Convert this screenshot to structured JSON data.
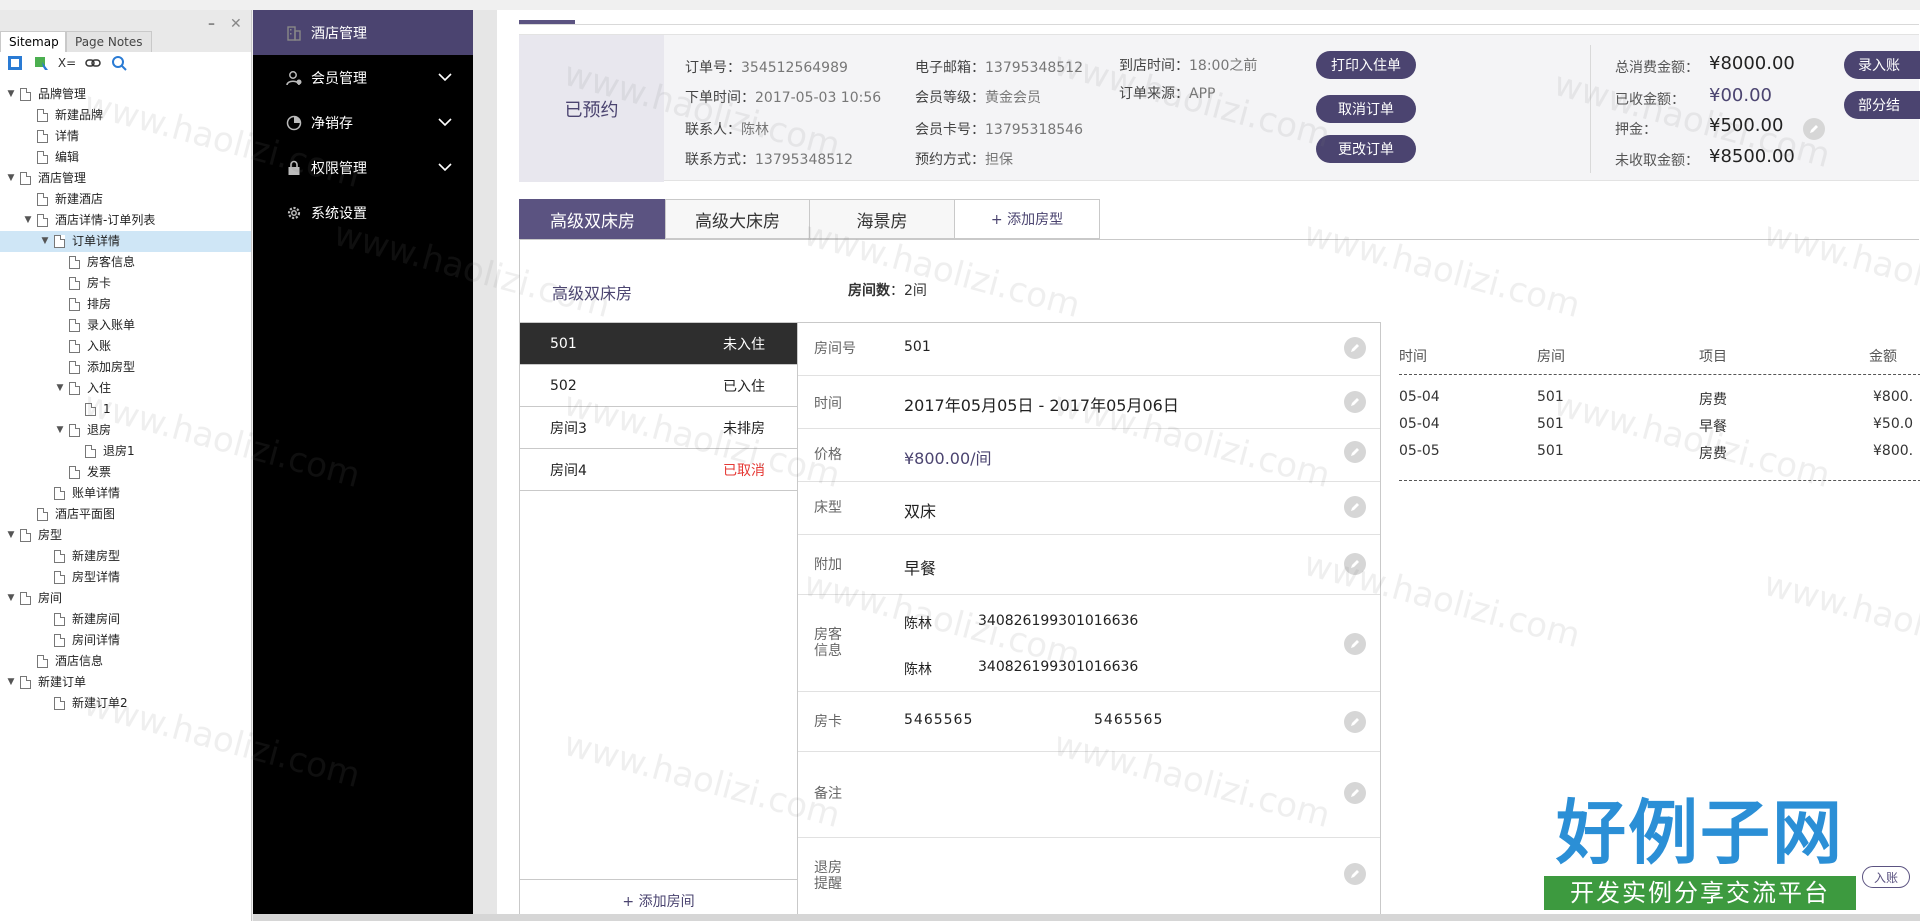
{
  "sitemap": {
    "tabs": [
      "Sitemap",
      "Page Notes"
    ],
    "tool_label": "X=",
    "tree": [
      {
        "label": "品牌管理",
        "depth": 0,
        "toggle": "▼",
        "page": true
      },
      {
        "label": "新建品牌",
        "depth": 2,
        "toggle": "",
        "page": true
      },
      {
        "label": "详情",
        "depth": 2,
        "toggle": "",
        "page": true
      },
      {
        "label": "编辑",
        "depth": 2,
        "toggle": "",
        "page": true
      },
      {
        "label": "酒店管理",
        "depth": 0,
        "toggle": "▼",
        "page": true
      },
      {
        "label": "新建酒店",
        "depth": 2,
        "toggle": "",
        "page": true
      },
      {
        "label": "酒店详情-订单列表",
        "depth": 2,
        "toggle": "▼",
        "page": true
      },
      {
        "label": "订单详情",
        "depth": 3,
        "toggle": "▼",
        "page": true,
        "selected": true
      },
      {
        "label": "房客信息",
        "depth": 4,
        "toggle": "",
        "page": true
      },
      {
        "label": "房卡",
        "depth": 4,
        "toggle": "",
        "page": true
      },
      {
        "label": "排房",
        "depth": 4,
        "toggle": "",
        "page": true
      },
      {
        "label": "录入账单",
        "depth": 4,
        "toggle": "",
        "page": true
      },
      {
        "label": "入账",
        "depth": 4,
        "toggle": "",
        "page": true
      },
      {
        "label": "添加房型",
        "depth": 4,
        "toggle": "",
        "page": true
      },
      {
        "label": "入住",
        "depth": 4,
        "toggle": "▼",
        "page": true
      },
      {
        "label": "1",
        "depth": 5,
        "toggle": "",
        "page": true
      },
      {
        "label": "退房",
        "depth": 4,
        "toggle": "▼",
        "page": true
      },
      {
        "label": "退房1",
        "depth": 5,
        "toggle": "",
        "page": true
      },
      {
        "label": "发票",
        "depth": 4,
        "toggle": "",
        "page": true
      },
      {
        "label": "账单详情",
        "depth": 3,
        "toggle": "",
        "page": true
      },
      {
        "label": "酒店平面图",
        "depth": 2,
        "toggle": "",
        "page": true
      },
      {
        "label": "房型",
        "depth": 1,
        "toggle": "▼",
        "page": true
      },
      {
        "label": "新建房型",
        "depth": 3,
        "toggle": "",
        "page": true
      },
      {
        "label": "房型详情",
        "depth": 3,
        "toggle": "",
        "page": true
      },
      {
        "label": "房间",
        "depth": 1,
        "toggle": "▼",
        "page": true
      },
      {
        "label": "新建房间",
        "depth": 3,
        "toggle": "",
        "page": true
      },
      {
        "label": "房间详情",
        "depth": 3,
        "toggle": "",
        "page": true
      },
      {
        "label": "酒店信息",
        "depth": 2,
        "toggle": "",
        "page": true
      },
      {
        "label": "新建订单",
        "depth": 1,
        "toggle": "▼",
        "page": true
      },
      {
        "label": "新建订单2",
        "depth": 3,
        "toggle": "",
        "page": true
      }
    ]
  },
  "nav": {
    "items": [
      {
        "label": "酒店管理",
        "icon": "building-icon",
        "active": true,
        "chevron": false
      },
      {
        "label": "会员管理",
        "icon": "member-icon",
        "active": false,
        "chevron": true
      },
      {
        "label": "净销存",
        "icon": "chart-icon",
        "active": false,
        "chevron": true
      },
      {
        "label": "权限管理",
        "icon": "lock-icon",
        "active": false,
        "chevron": true
      },
      {
        "label": "系统设置",
        "icon": "gear-icon",
        "active": false,
        "chevron": false
      }
    ]
  },
  "order": {
    "status": "已预约",
    "fields": {
      "order_no_k": "订单号：",
      "order_no_v": "354512564989",
      "order_time_k": "下单时间：",
      "order_time_v": "2017-05-03  10:56",
      "contact_k": "联系人：",
      "contact_v": "陈林",
      "phone_k": "联系方式：",
      "phone_v": "13795348512",
      "email_k": "电子邮箱：",
      "email_v": "13795348512",
      "level_k": "会员等级：",
      "level_v": "黄金会员",
      "card_k": "会员卡号：",
      "card_v": "13795318546",
      "book_k": "预约方式：",
      "book_v": "担保",
      "arrive_k": "到店时间：",
      "arrive_v": "18:00之前",
      "source_k": "订单来源：",
      "source_v": "APP"
    },
    "buttons": {
      "print": "打印入住单",
      "cancel": "取消订单",
      "change": "更改订单"
    },
    "amounts": {
      "total_k": "总消费金额：",
      "total_v": "¥8000.00",
      "paid_k": "已收金额：",
      "paid_v": "¥00.00",
      "deposit_k": "押金：",
      "deposit_v": "¥500.00",
      "unpaid_k": "未收取金额：",
      "unpaid_v": "¥8500.00"
    },
    "right_buttons": {
      "enter": "录入账",
      "partial": "部分结"
    }
  },
  "room_tabs": [
    "高级双床房",
    "高级大床房",
    "海景房",
    "+ 添加房型"
  ],
  "room_type": {
    "title": "高级双床房",
    "count_k": "房间数",
    "count_v": "：2间"
  },
  "rooms": [
    {
      "no": "501",
      "status": "未入住",
      "active": true,
      "cancel": false
    },
    {
      "no": "502",
      "status": "已入住",
      "active": false,
      "cancel": false
    },
    {
      "no": "房间3",
      "status": "未排房",
      "active": false,
      "cancel": false
    },
    {
      "no": "房间4",
      "status": "已取消",
      "active": false,
      "cancel": true
    }
  ],
  "add_room": "+ 添加房间",
  "details": {
    "room_no_l": "房间号",
    "room_no_v": "501",
    "time_l": "时间",
    "time_v": "2017年05月05日   -   2017年05月06日",
    "price_l": "价格",
    "price_v": "¥800.00/间",
    "bed_l": "床型",
    "bed_v": "双床",
    "extra_l": "附加",
    "extra_v": "早餐",
    "guest_l": "房客\n信息",
    "guests": [
      {
        "name": "陈林",
        "id": "340826199301016636"
      },
      {
        "name": "陈林",
        "id": "340826199301016636"
      }
    ],
    "card_l": "房卡",
    "cards": [
      "5465565",
      "5465565"
    ],
    "note_l": "备注",
    "remind_l": "退房\n提醒"
  },
  "bill": {
    "headers": [
      "时间",
      "房间",
      "项目",
      "金额"
    ],
    "rows": [
      [
        "05-04",
        "501",
        "房费",
        "¥800."
      ],
      [
        "05-04",
        "501",
        "早餐",
        "¥50.0"
      ],
      [
        "05-05",
        "501",
        "房费",
        "¥800."
      ]
    ]
  },
  "watermark": {
    "logo": "好例子网",
    "slogan": "开发实例分享交流平台",
    "text": "www.haolizi.com",
    "corner_btn": "入账"
  },
  "colors": {
    "accent": "#4b4470",
    "danger": "#e53935",
    "nav_bg": "#000000"
  }
}
